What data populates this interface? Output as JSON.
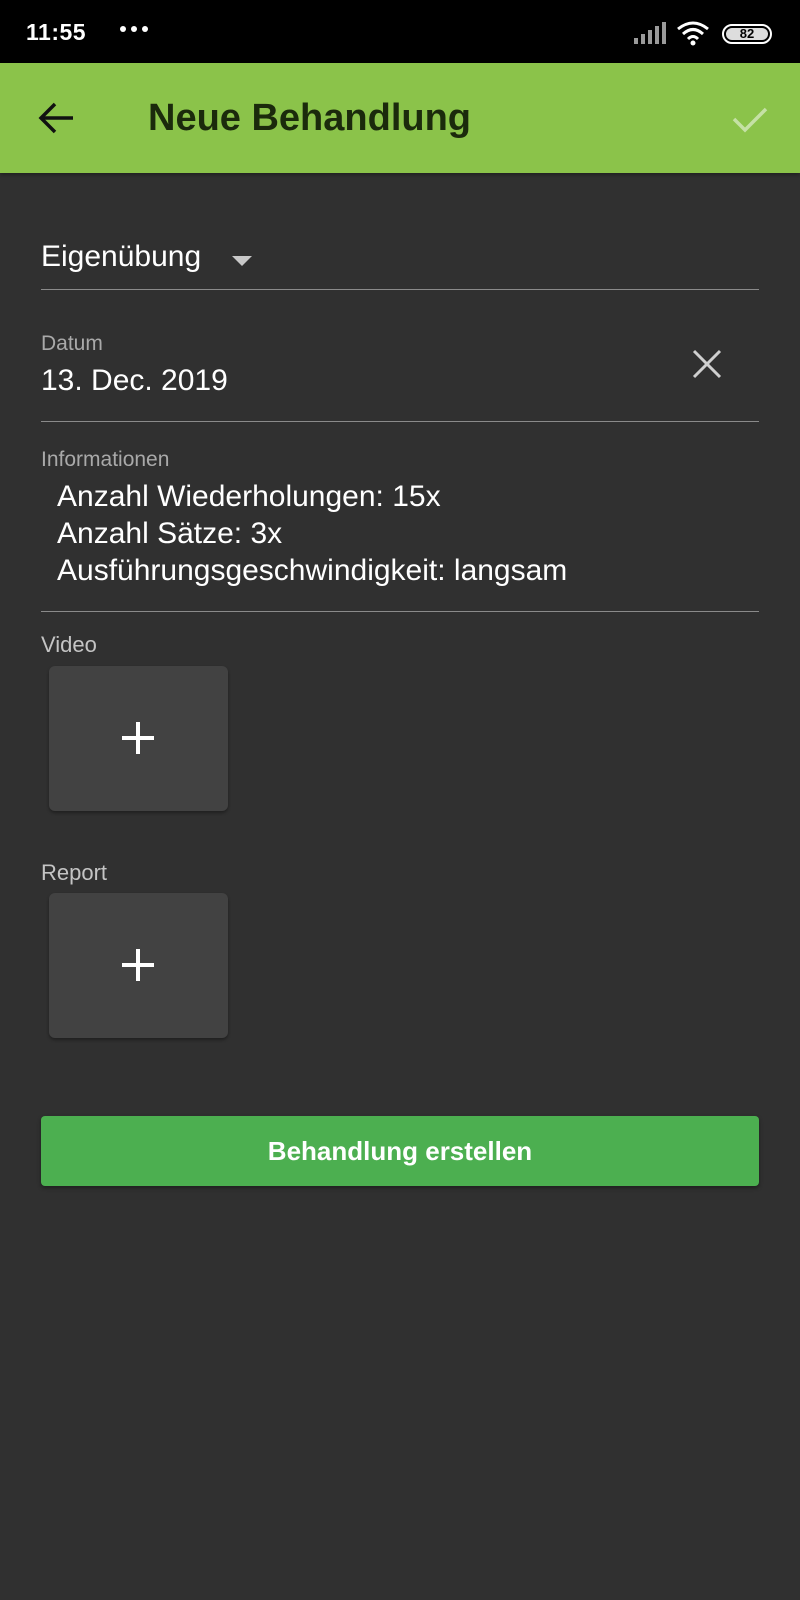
{
  "status_bar": {
    "time": "11:55",
    "battery": "82",
    "icons": [
      "more-dots-icon",
      "signal-icon",
      "wifi-icon",
      "battery-icon"
    ]
  },
  "app_bar": {
    "title": "Neue Behandlung",
    "back_icon": "arrow-back-icon",
    "confirm_icon": "check-icon",
    "background_color": "#8bc34a"
  },
  "form": {
    "type_dropdown": {
      "selected": "Eigenübung"
    },
    "date": {
      "label": "Datum",
      "value": "13. Dec. 2019",
      "clear_icon": "close-icon"
    },
    "info": {
      "label": "Informationen",
      "lines": [
        "Anzahl Wiederholungen: 15x",
        "Anzahl Sätze: 3x",
        "Ausführungsgeschwindigkeit: langsam"
      ]
    },
    "video": {
      "label": "Video",
      "add_icon": "plus-icon"
    },
    "report": {
      "label": "Report",
      "add_icon": "plus-icon"
    }
  },
  "submit_button": {
    "label": "Behandlung erstellen",
    "color": "#4caf50"
  }
}
